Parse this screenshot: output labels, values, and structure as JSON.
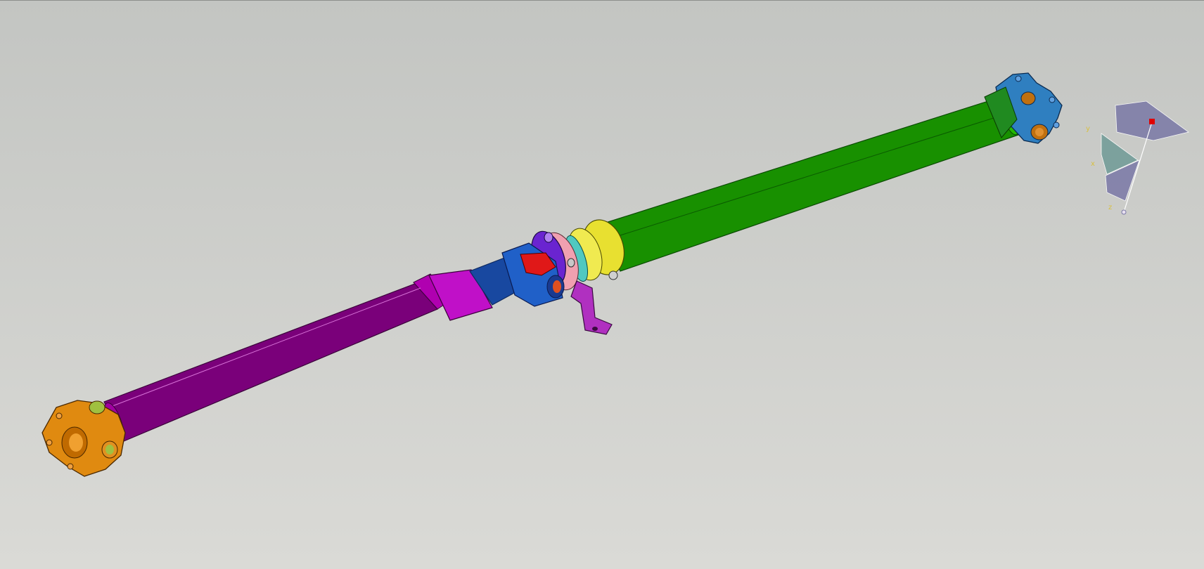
{
  "viewer": {
    "background_top": "#c3c5c2",
    "background_bottom": "#dadad6"
  },
  "part_colors": {
    "rear_tube": "#c800c8",
    "front_tube": "#2ed800",
    "stub_shaft": "#1f6fd0",
    "flange_left": "#e08a10",
    "flange_right": "#2f7fc0",
    "center_joint": "#6a24d0",
    "center_bearing": "#e8e030",
    "bearing_ring": "#50c8c0",
    "support_bracket": "#b030c0",
    "yoke_red": "#e01818",
    "washer_pink": "#f0a0b0"
  },
  "compass": {
    "axis_x": "x",
    "axis_y": "y",
    "axis_z": "z",
    "plane_color": "#7a78a6",
    "marker_color": "#e00000",
    "label_color": "#d8c040"
  }
}
